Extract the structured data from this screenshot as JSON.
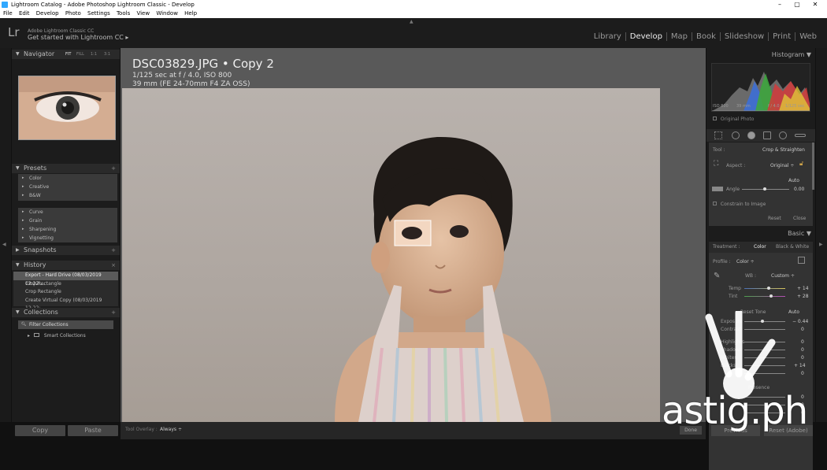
{
  "window": {
    "title": "Lightroom Catalog - Adobe Photoshop Lightroom Classic - Develop",
    "controls": {
      "minimize": "–",
      "maximize": "▢",
      "close": "✕"
    }
  },
  "menu": [
    "File",
    "Edit",
    "Develop",
    "Photo",
    "Settings",
    "Tools",
    "View",
    "Window",
    "Help"
  ],
  "identity": {
    "logo": "Lr",
    "small": "Adobe Lightroom Classic CC",
    "big": "Get started with Lightroom CC ▸"
  },
  "modules": [
    "Library",
    "Develop",
    "Map",
    "Book",
    "Slideshow",
    "Print",
    "Web"
  ],
  "modules_active": "Develop",
  "left": {
    "navigator": {
      "title": "Navigator",
      "zoom": [
        "FIT",
        "FILL",
        "1:1",
        "3:1"
      ]
    },
    "presets": {
      "title": "Presets",
      "group1": [
        "Color",
        "Creative",
        "B&W"
      ],
      "group2": [
        "Curve",
        "Grain",
        "Sharpening",
        "Vignetting"
      ]
    },
    "snapshots": {
      "title": "Snapshots"
    },
    "history": {
      "title": "History",
      "items": [
        "Export - Hard Drive (08/03/2019 12:22:...",
        "Crop Rectangle",
        "Crop Rectangle",
        "Create Virtual Copy (08/03/2019 12:22:..."
      ]
    },
    "collections": {
      "title": "Collections",
      "filter": "Filter Collections",
      "smart": "Smart Collections"
    },
    "copy": "Copy",
    "paste": "Paste"
  },
  "photo": {
    "name": "DSC03829.JPG  •  Copy 2",
    "exposure": "1/125 sec at f / 4.0, ISO 800",
    "lens": "39 mm (FE 24-70mm F4 ZA OSS)"
  },
  "toolbar": {
    "label": "Tool Overlay :",
    "value": "Always ÷",
    "done": "Done"
  },
  "right": {
    "histogram": {
      "title": "Histogram ▼",
      "iso": "ISO 800",
      "focal": "39 mm",
      "aperture": "f / 4.0",
      "shutter": "1/125 sec",
      "original": "Original Photo"
    },
    "crop": {
      "tool": "Tool :",
      "tool_name": "Crop & Straighten",
      "aspect": "Aspect :",
      "aspect_val": "Original ÷",
      "auto": "Auto",
      "angle": "Angle",
      "angle_val": "0.00",
      "constrain": "Constrain to Image",
      "reset": "Reset",
      "close": "Close"
    },
    "basic": {
      "title": "Basic ▼",
      "treatment": "Treatment :",
      "color": "Color",
      "bw": "Black & White",
      "profile": "Profile :",
      "profile_val": "Color ÷",
      "wb": "WB :",
      "wb_val": "Custom ÷",
      "temp": "Temp",
      "temp_val": "+ 14",
      "tint": "Tint",
      "tint_val": "+ 28",
      "tone": "Reset Tone",
      "tone_auto": "Auto",
      "exposure": "Exposure",
      "exposure_val": "− 0.44",
      "rows": [
        {
          "label": "Contrast",
          "val": "0"
        },
        {
          "label": "Highlights",
          "val": "0"
        },
        {
          "label": "Shadows",
          "val": "0"
        },
        {
          "label": "Whites",
          "val": "0"
        },
        {
          "label": "Blacks",
          "val": "+ 14"
        },
        {
          "label": "",
          "val": "0"
        }
      ],
      "presence": "Presence",
      "presence_rows": [
        "0",
        "0",
        "0"
      ]
    },
    "prev": "Previous",
    "reset_btn": "Reset (Adobe)"
  },
  "watermark": "astig.ph"
}
